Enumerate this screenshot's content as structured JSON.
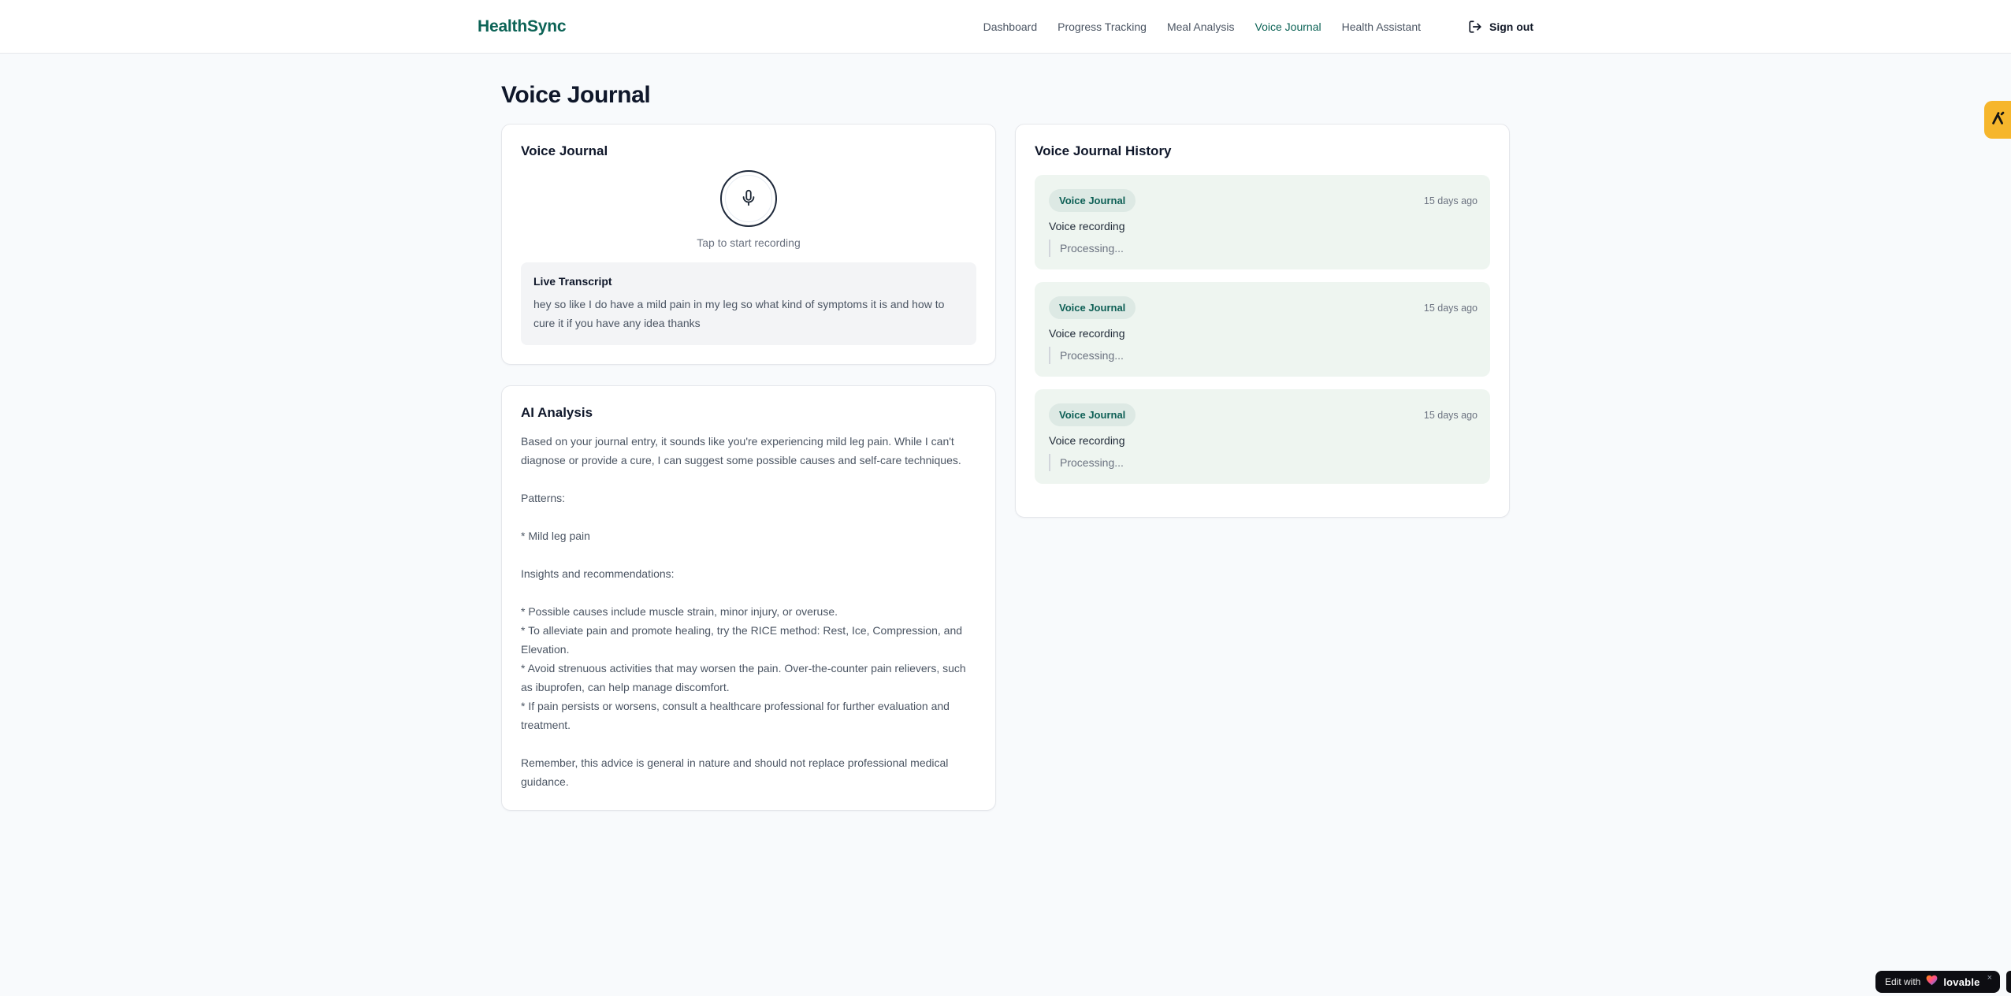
{
  "colors": {
    "accent": "#0c6356",
    "nav-text": "#4b5563",
    "text-dark": "#0f172a",
    "text-muted": "#6b7280",
    "page-bg": "#f8fafc",
    "card-border": "#e5e7eb",
    "entry-bg": "#eef5f0",
    "badge-bg": "#dde9e4",
    "badge-text": "#0d5f55",
    "transcript-bg": "#f3f4f6",
    "mic-border": "#1e293b",
    "amber": "#f6b62c",
    "lovable-bg": "#0d0d12"
  },
  "header": {
    "brand": "HealthSync",
    "nav": {
      "items": [
        {
          "label": "Dashboard"
        },
        {
          "label": "Progress Tracking"
        },
        {
          "label": "Meal Analysis"
        },
        {
          "label": "Voice Journal"
        },
        {
          "label": "Health Assistant"
        }
      ],
      "active_label": "Voice Journal",
      "sign_out_label": "Sign out"
    }
  },
  "page": {
    "title": "Voice Journal"
  },
  "recorder": {
    "card_title": "Voice Journal",
    "mic_hint": "Tap to start recording",
    "transcript": {
      "title": "Live Transcript",
      "text": "hey so like I do have a mild pain in my leg so what kind of symptoms it is and how to cure it if you have any idea thanks"
    }
  },
  "analysis": {
    "card_title": "AI Analysis",
    "body": "Based on your journal entry, it sounds like you're experiencing mild leg pain. While I can't diagnose or provide a cure, I can suggest some possible causes and self-care techniques.\n\nPatterns:\n\n* Mild leg pain\n\nInsights and recommendations:\n\n* Possible causes include muscle strain, minor injury, or overuse.\n* To alleviate pain and promote healing, try the RICE method: Rest, Ice, Compression, and Elevation.\n* Avoid strenuous activities that may worsen the pain. Over-the-counter pain relievers, such as ibuprofen, can help manage discomfort.\n* If pain persists or worsens, consult a healthcare professional for further evaluation and treatment.\n\nRemember, this advice is general in nature and should not replace professional medical guidance."
  },
  "history": {
    "card_title": "Voice Journal History",
    "entries": [
      {
        "badge": "Voice Journal",
        "time": "15 days ago",
        "label": "Voice recording",
        "status": "Processing..."
      },
      {
        "badge": "Voice Journal",
        "time": "15 days ago",
        "label": "Voice recording",
        "status": "Processing..."
      },
      {
        "badge": "Voice Journal",
        "time": "15 days ago",
        "label": "Voice recording",
        "status": "Processing..."
      }
    ]
  },
  "floating": {
    "edit_prefix": "Edit with",
    "brand": "lovable",
    "close_label": "×"
  }
}
